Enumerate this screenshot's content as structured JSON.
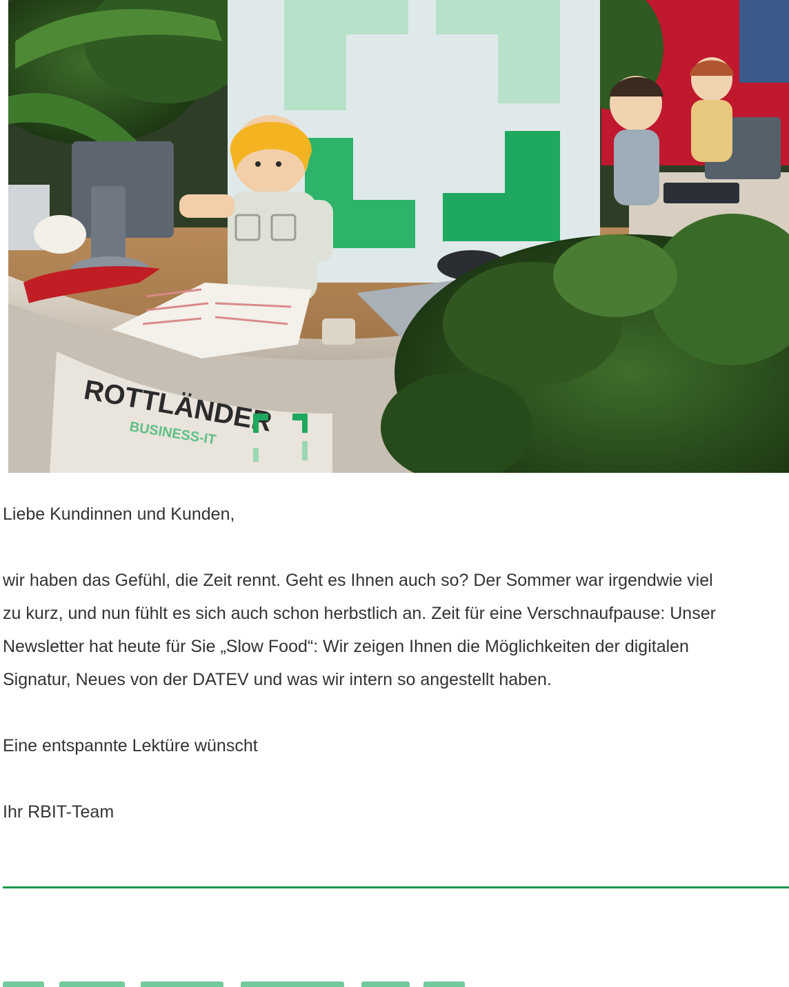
{
  "hero": {
    "alt": "Playmobil-Büroszene mit Empfangstheke ROTTLÄNDER BUSINESS-IT",
    "counter_brand": "ROTTLÄNDER",
    "counter_sub": "BUSINESS-IT",
    "colors": {
      "brand_green": "#1a9a48",
      "light_green": "#7fd0a6",
      "counter": "#cfc7bb",
      "wall_red": "#c0182e"
    }
  },
  "message": {
    "greeting": "Liebe Kundinnen und Kunden,",
    "body_lines": [
      "wir haben das Gefühl, die Zeit rennt. Geht es Ihnen auch so? Der Sommer war irgendwie viel",
      "zu kurz, und nun fühlt es sich auch schon herbstlich an. Zeit für eine Verschnaufpause: Unser",
      "Newsletter hat heute für Sie „Slow Food“: Wir zeigen Ihnen die Möglichkeiten der digitalen",
      "Signatur, Neues von der DATEV und was wir intern so angestellt haben."
    ],
    "closing": "Eine entspannte Lektüre wünscht",
    "signature": "Ihr RBIT-Team"
  },
  "divider": {
    "color": "#1a9a48"
  }
}
